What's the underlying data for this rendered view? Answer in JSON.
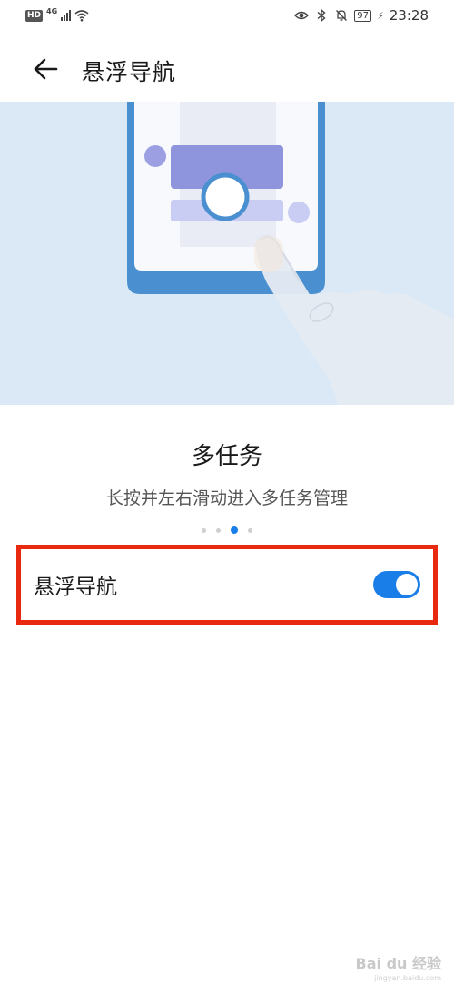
{
  "status_bar": {
    "left_badge": "HD",
    "network_type": "4G",
    "battery": "97",
    "time": "23:28",
    "icons": [
      "hd-icon",
      "signal-icon",
      "wifi-icon",
      "eye-icon",
      "bluetooth-icon",
      "mute-bell-icon",
      "battery-icon",
      "charging-icon"
    ]
  },
  "header": {
    "title": "悬浮导航",
    "back_icon": "arrow-left-icon"
  },
  "feature": {
    "title": "多任务",
    "description": "长按并左右滑动进入多任务管理"
  },
  "pager": {
    "count": 4,
    "active_index": 2
  },
  "setting": {
    "label": "悬浮导航",
    "toggle_on": true
  },
  "colors": {
    "accent": "#1a7ee8",
    "highlight_border": "#e8280f",
    "hero_background": "#dbe9f6"
  },
  "watermark": {
    "text": "Bai du 经验",
    "sub": "jingyan.baidu.com"
  }
}
